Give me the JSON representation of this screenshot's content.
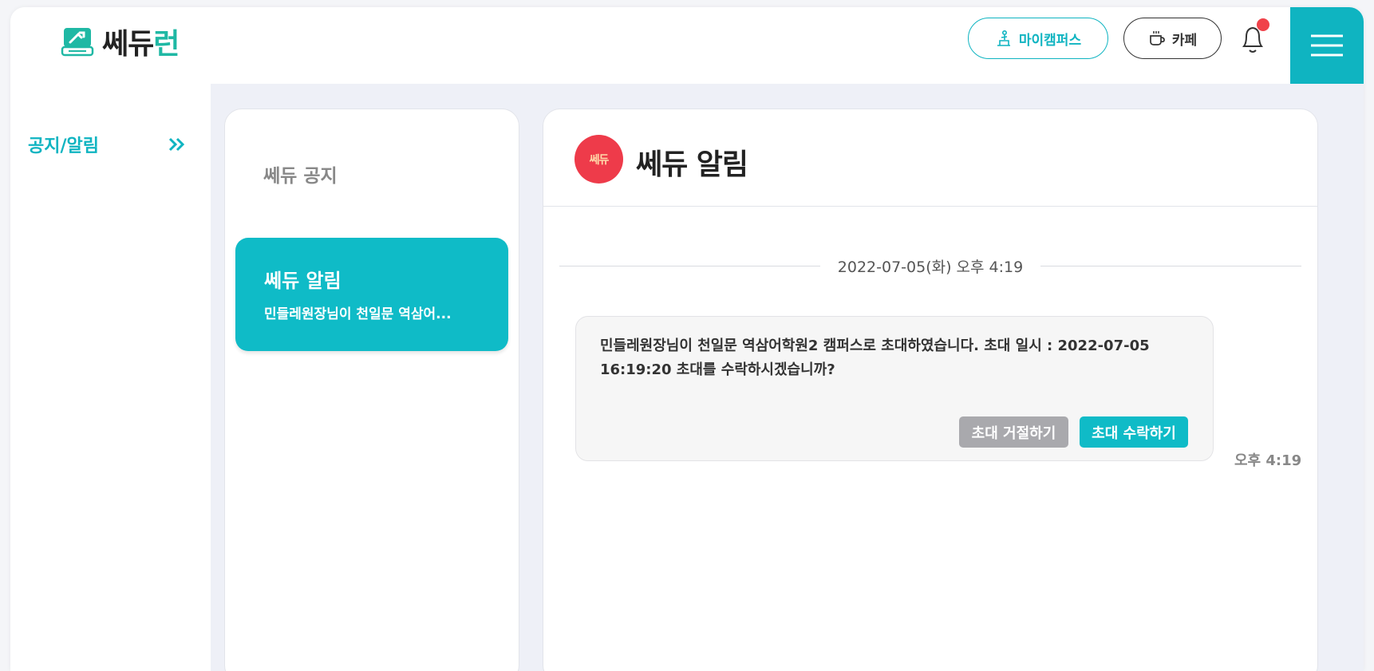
{
  "header": {
    "logo_main": "쎄듀",
    "logo_accent": "런",
    "mycampus_label": "마이캠퍼스",
    "cafe_label": "카페"
  },
  "sidebar": {
    "items": [
      {
        "label": "공지/알림"
      }
    ]
  },
  "list": {
    "items": [
      {
        "title": "쎄듀 공지"
      },
      {
        "title": "쎄듀 알림",
        "preview": "민들레원장님이 천일문 역삼어..."
      }
    ]
  },
  "chat": {
    "avatar_text": "쎄듀",
    "title": "쎄듀 알림",
    "date_separator": "2022-07-05(화) 오후 4:19",
    "message": {
      "text": "민들레원장님이 천일문 역삼어학원2 캠퍼스로 초대하였습니다. 초대 일시 : 2022-07-05 16:19:20 초대를 수락하시겠습니까?",
      "reject_label": "초대 거절하기",
      "accept_label": "초대 수락하기",
      "time": "오후 4:19"
    }
  },
  "colors": {
    "accent": "#0fb4c1",
    "logo_green": "#1fb8a4",
    "badge_red": "#f0424a",
    "avatar_red": "#ee3b4a"
  }
}
